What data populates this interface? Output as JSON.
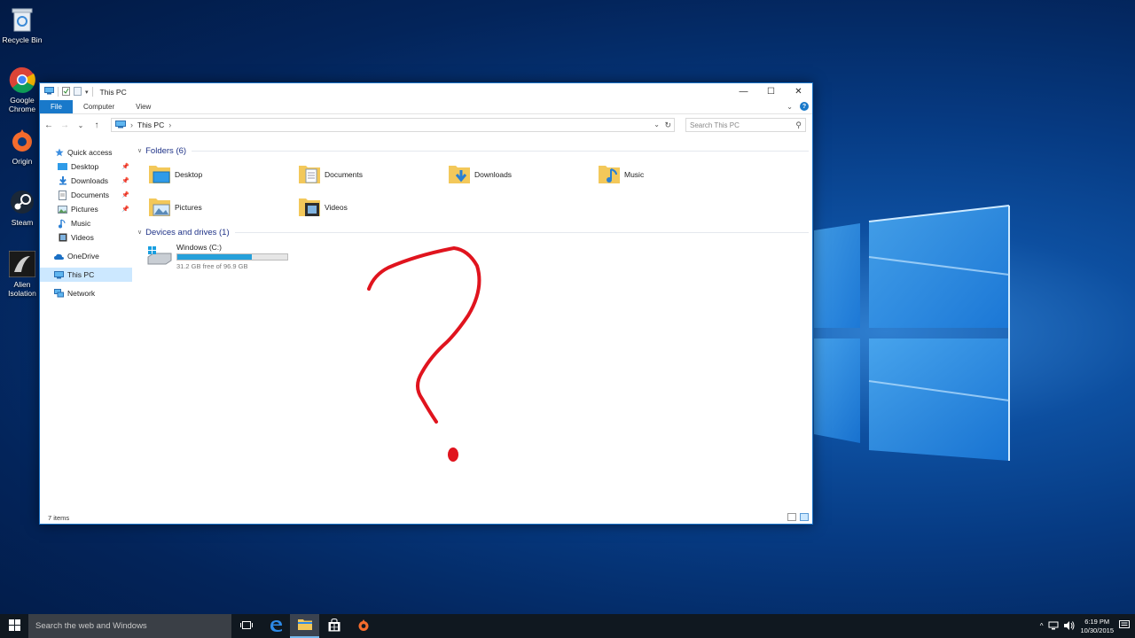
{
  "desktop": {
    "icons": [
      {
        "label": "Recycle Bin",
        "icon": "recycle-bin-icon"
      },
      {
        "label": "Google Chrome",
        "icon": "chrome-icon"
      },
      {
        "label": "Origin",
        "icon": "origin-icon"
      },
      {
        "label": "Steam",
        "icon": "steam-icon"
      },
      {
        "label": "Alien Isolation",
        "icon": "alien-isolation-icon"
      }
    ]
  },
  "window": {
    "title": "This PC",
    "controls": {
      "minimize": "—",
      "maximize": "☐",
      "close": "✕"
    }
  },
  "ribbon": {
    "tabs": [
      "File",
      "Computer",
      "View"
    ],
    "help": "?"
  },
  "address": {
    "back": "←",
    "forward": "→",
    "recent": "⌄",
    "up": "↑",
    "path": "This PC",
    "sep": "›",
    "dropdown": "⌄",
    "refresh": "↻",
    "search_placeholder": "Search This PC",
    "search_icon": "⚲"
  },
  "nav": {
    "quick_access": "Quick access",
    "quick_items": [
      {
        "label": "Desktop",
        "icon": "desktop-folder-icon",
        "pinned": true
      },
      {
        "label": "Downloads",
        "icon": "downloads-icon",
        "pinned": true
      },
      {
        "label": "Documents",
        "icon": "documents-icon",
        "pinned": true
      },
      {
        "label": "Pictures",
        "icon": "pictures-icon",
        "pinned": true
      },
      {
        "label": "Music",
        "icon": "music-icon",
        "pinned": false
      },
      {
        "label": "Videos",
        "icon": "videos-icon",
        "pinned": false
      }
    ],
    "pin_glyph": "📌",
    "onedrive": "OneDrive",
    "this_pc": "This PC",
    "network": "Network"
  },
  "content": {
    "folders_header": "Folders (6)",
    "folders": [
      {
        "label": "Desktop",
        "icon": "desktop-folder-icon"
      },
      {
        "label": "Documents",
        "icon": "documents-folder-icon"
      },
      {
        "label": "Downloads",
        "icon": "downloads-folder-icon"
      },
      {
        "label": "Music",
        "icon": "music-folder-icon"
      },
      {
        "label": "Pictures",
        "icon": "pictures-folder-icon"
      },
      {
        "label": "Videos",
        "icon": "videos-folder-icon"
      }
    ],
    "devices_header": "Devices and drives (1)",
    "drive": {
      "name": "Windows (C:)",
      "free_text": "31.2 GB free of 96.9 GB",
      "used_fraction": 0.678
    }
  },
  "status": {
    "items": "7 items"
  },
  "taskbar": {
    "search_placeholder": "Search the web and Windows",
    "time": "6:19 PM",
    "date": "10/30/2015",
    "tray_chevron": "^"
  },
  "colors": {
    "accent": "#1979ca",
    "selection": "#cce8ff",
    "drive_fill": "#26a0da",
    "scribble": "#e0141e"
  }
}
